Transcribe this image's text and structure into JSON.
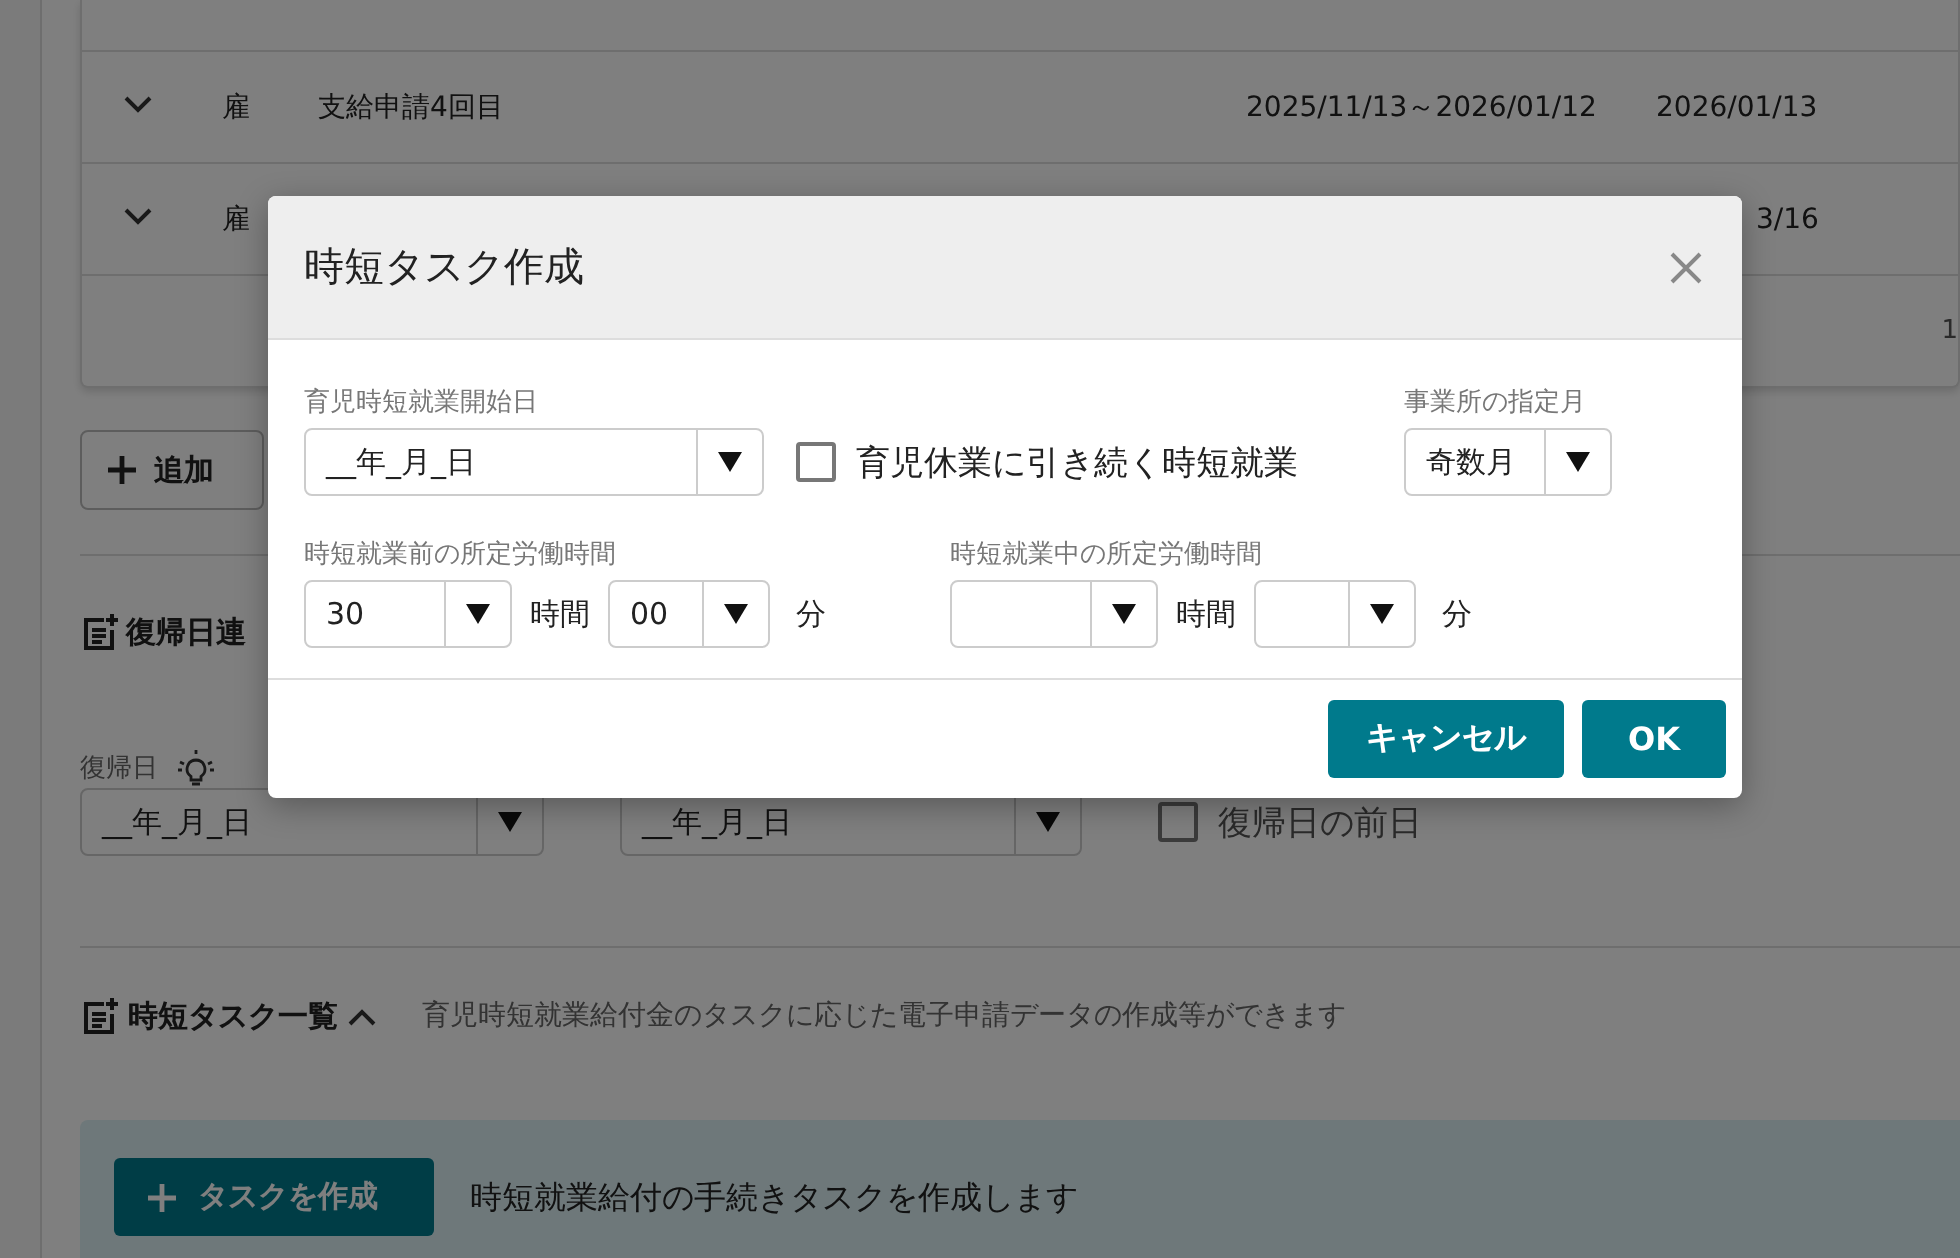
{
  "background": {
    "table": {
      "rows": [
        {
          "expanded": false,
          "type": "雇",
          "name": "支給申請4回目",
          "period": "2025/11/13～2026/01/12",
          "date": "2026/01/13"
        },
        {
          "expanded": false,
          "type": "雇",
          "date": "3/16"
        }
      ],
      "pager": "1"
    },
    "add_button": "追加",
    "return_section": {
      "title": "復帰日連",
      "date_label": "復帰日",
      "date_field_1": "__年_月_日",
      "date_field_2": "__年_月_日",
      "checkbox": {
        "label": "復帰日の前日",
        "checked": false
      }
    },
    "task_section": {
      "title": "時短タスク一覧",
      "expanded": true,
      "description": "育児時短就業給付金のタスクに応じた電子申請データの作成等ができます",
      "create_button": "タスクを作成",
      "create_text": "時短就業給付の手続きタスクを作成します"
    }
  },
  "dialog": {
    "title": "時短タスク作成",
    "start_date": {
      "label": "育児時短就業開始日",
      "value": "__年_月_日"
    },
    "continuation": {
      "label": "育児休業に引き続く時短就業",
      "checked": false
    },
    "designated_month": {
      "label": "事業所の指定月",
      "value": "奇数月"
    },
    "hours_before": {
      "label": "時短就業前の所定労働時間",
      "hours": "30",
      "hours_unit": "時間",
      "minutes": "00",
      "minutes_unit": "分"
    },
    "hours_during": {
      "label": "時短就業中の所定労働時間",
      "hours_unit": "時間",
      "minutes_unit": "分"
    },
    "buttons": [
      {
        "label": "キャンセル"
      },
      {
        "label": "OK"
      }
    ]
  }
}
